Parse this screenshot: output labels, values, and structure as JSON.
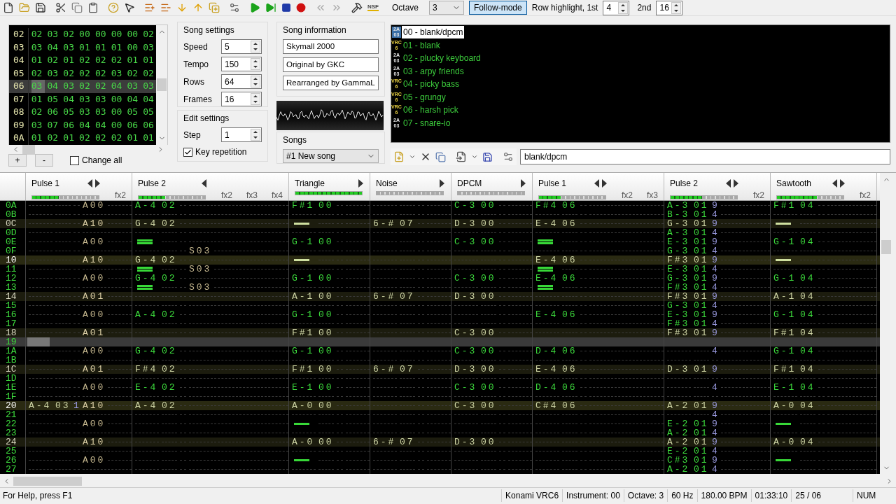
{
  "toolbar": {
    "nsf_label": "NSF",
    "octave_label": "Octave",
    "octave": "3",
    "follow_mode": {
      "label": "Follow-mode",
      "on": true
    },
    "row_highlight_label": "Row highlight, 1st",
    "highlight_1st": "4",
    "second_label": "2nd",
    "highlight_2nd": "16"
  },
  "frames": {
    "rows": [
      {
        "label": "02",
        "values": [
          "02",
          "03",
          "02",
          "00",
          "00",
          "00",
          "00",
          "02"
        ],
        "selected": false
      },
      {
        "label": "03",
        "values": [
          "03",
          "04",
          "03",
          "01",
          "01",
          "01",
          "00",
          "03"
        ],
        "selected": false
      },
      {
        "label": "04",
        "values": [
          "01",
          "02",
          "01",
          "02",
          "02",
          "02",
          "01",
          "01"
        ],
        "selected": false
      },
      {
        "label": "05",
        "values": [
          "02",
          "03",
          "02",
          "02",
          "02",
          "03",
          "02",
          "02"
        ],
        "selected": false
      },
      {
        "label": "06",
        "values": [
          "03",
          "04",
          "03",
          "02",
          "02",
          "04",
          "03",
          "03"
        ],
        "selected": true
      },
      {
        "label": "07",
        "values": [
          "01",
          "05",
          "04",
          "03",
          "03",
          "00",
          "04",
          "04"
        ],
        "selected": false
      },
      {
        "label": "08",
        "values": [
          "02",
          "06",
          "05",
          "03",
          "03",
          "00",
          "05",
          "05"
        ],
        "selected": false
      },
      {
        "label": "09",
        "values": [
          "03",
          "07",
          "06",
          "04",
          "04",
          "00",
          "06",
          "06"
        ],
        "selected": false
      },
      {
        "label": "0A",
        "values": [
          "01",
          "02",
          "01",
          "02",
          "02",
          "02",
          "01",
          "01"
        ],
        "selected": false
      }
    ],
    "add": "+",
    "remove": "-",
    "change_all": {
      "label": "Change all",
      "checked": false
    }
  },
  "song_settings": {
    "title": "Song settings",
    "fields": [
      {
        "label": "Speed",
        "value": "5"
      },
      {
        "label": "Tempo",
        "value": "150"
      },
      {
        "label": "Rows",
        "value": "64"
      },
      {
        "label": "Frames",
        "value": "16"
      }
    ]
  },
  "edit_settings": {
    "title": "Edit settings",
    "step": {
      "label": "Step",
      "value": "1"
    },
    "key_repetition": {
      "label": "Key repetition",
      "checked": true
    }
  },
  "song_information": {
    "title": "Song information",
    "fields": [
      "Skymall 2000",
      "Original by GKC",
      "Rearranged by GammaL"
    ]
  },
  "songs": {
    "title": "Songs",
    "value": "#1 New song"
  },
  "instruments": {
    "items": [
      {
        "chip": [
          "2A",
          "03"
        ],
        "kind": "apu",
        "label": "00 - blank/dpcm",
        "selected": true
      },
      {
        "chip": [
          "VRC",
          "6"
        ],
        "kind": "vrc",
        "label": "01 - blank",
        "selected": false
      },
      {
        "chip": [
          "2A",
          "03"
        ],
        "kind": "apu",
        "label": "02 - plucky keyboard",
        "selected": false
      },
      {
        "chip": [
          "2A",
          "03"
        ],
        "kind": "apu",
        "label": "03 - arpy friends",
        "selected": false
      },
      {
        "chip": [
          "VRC",
          "6"
        ],
        "kind": "vrc",
        "label": "04 - picky bass",
        "selected": false
      },
      {
        "chip": [
          "VRC",
          "6"
        ],
        "kind": "vrc",
        "label": "05 - grungy",
        "selected": false
      },
      {
        "chip": [
          "VRC",
          "6"
        ],
        "kind": "vrc",
        "label": "06 - harsh pick",
        "selected": false
      },
      {
        "chip": [
          "2A",
          "03"
        ],
        "kind": "apu",
        "label": "07 - snare-io",
        "selected": false
      }
    ],
    "name": "blank/dpcm"
  },
  "pattern": {
    "channels": [
      {
        "name": "Pulse 1",
        "left_arrow": true,
        "right_arrow": true,
        "level": 0.4,
        "fx_labels": [
          "fx2"
        ]
      },
      {
        "name": "Pulse 2",
        "left_arrow": true,
        "right_arrow": false,
        "level": 0.4,
        "fx_labels": [
          "fx2",
          "fx3",
          "fx4"
        ]
      },
      {
        "name": "Triangle",
        "left_arrow": false,
        "right_arrow": true,
        "level": 1
      },
      {
        "name": "Noise",
        "left_arrow": false,
        "right_arrow": true,
        "level": 0
      },
      {
        "name": "DPCM",
        "left_arrow": false,
        "right_arrow": true,
        "level": 0
      },
      {
        "name": "Pulse 1",
        "left_arrow": true,
        "right_arrow": true,
        "level": 0.33,
        "fx_labels": [
          "fx2",
          "fx3"
        ]
      },
      {
        "name": "Pulse 2",
        "left_arrow": true,
        "right_arrow": true,
        "level": 0.47,
        "fx_labels": [
          "fx2"
        ]
      },
      {
        "name": "Sawtooth",
        "left_arrow": true,
        "right_arrow": true,
        "level": 0.6,
        "fx_labels": [
          "fx2"
        ]
      }
    ],
    "rows": [
      {
        "label": "0A",
        "beat": false,
        "measure": false,
        "selected": false,
        "cells": [
          {
            "kind": "note",
            "fx1": "A00"
          },
          {
            "kind": "note",
            "note": "A-4",
            "instrument": "02"
          },
          {
            "kind": "note",
            "note": "F#1",
            "instrument": "00"
          },
          null,
          {
            "kind": "note",
            "note": "C-3",
            "instrument": "00"
          },
          {
            "kind": "note",
            "note": "F#4",
            "instrument": "06"
          },
          {
            "kind": "note",
            "note": "A-3",
            "instrument": "01",
            "volume": "9"
          },
          {
            "kind": "note",
            "note": "F#1",
            "instrument": "04"
          }
        ]
      },
      {
        "label": "0B",
        "beat": false,
        "measure": false,
        "selected": false,
        "cells": [
          null,
          null,
          null,
          null,
          null,
          null,
          {
            "kind": "note",
            "note": "B-3",
            "instrument": "01",
            "volume": "4"
          },
          null
        ]
      },
      {
        "label": "0C",
        "beat": true,
        "measure": false,
        "selected": false,
        "cells": [
          {
            "kind": "note",
            "fx1": "A10"
          },
          {
            "kind": "note",
            "note": "G-4",
            "instrument": "02"
          },
          {
            "kind": "off"
          },
          {
            "kind": "note",
            "note": "6-#",
            "instrument": "07"
          },
          {
            "kind": "note",
            "note": "D-3",
            "instrument": "00"
          },
          {
            "kind": "note",
            "note": "E-4",
            "instrument": "06"
          },
          {
            "kind": "note",
            "note": "G-3",
            "instrument": "01",
            "volume": "9"
          },
          {
            "kind": "off"
          }
        ]
      },
      {
        "label": "0D",
        "beat": false,
        "measure": false,
        "selected": false,
        "cells": [
          null,
          null,
          null,
          null,
          null,
          null,
          {
            "kind": "note",
            "note": "A-3",
            "instrument": "01",
            "volume": "4"
          },
          null
        ]
      },
      {
        "label": "0E",
        "beat": false,
        "measure": false,
        "selected": false,
        "cells": [
          {
            "kind": "note",
            "fx1": "A00"
          },
          {
            "kind": "release"
          },
          {
            "kind": "note",
            "note": "G-1",
            "instrument": "00"
          },
          null,
          {
            "kind": "note",
            "note": "C-3",
            "instrument": "00"
          },
          {
            "kind": "release"
          },
          {
            "kind": "note",
            "note": "E-3",
            "instrument": "01",
            "volume": "9"
          },
          {
            "kind": "note",
            "note": "G-1",
            "instrument": "04"
          }
        ]
      },
      {
        "label": "0F",
        "beat": false,
        "measure": false,
        "selected": false,
        "cells": [
          null,
          {
            "kind": "note",
            "fx1": "S03"
          },
          null,
          null,
          null,
          null,
          {
            "kind": "note",
            "note": "G-3",
            "instrument": "01",
            "volume": "4"
          },
          null
        ]
      },
      {
        "label": "10",
        "beat": true,
        "measure": true,
        "selected": false,
        "cells": [
          {
            "kind": "note",
            "fx1": "A10"
          },
          {
            "kind": "note",
            "note": "G-4",
            "instrument": "02"
          },
          {
            "kind": "off"
          },
          null,
          null,
          {
            "kind": "note",
            "note": "E-4",
            "instrument": "06"
          },
          {
            "kind": "note",
            "note": "F#3",
            "instrument": "01",
            "volume": "9"
          },
          {
            "kind": "off"
          }
        ]
      },
      {
        "label": "11",
        "beat": false,
        "measure": false,
        "selected": false,
        "cells": [
          null,
          {
            "kind": "release",
            "fx1": "S03"
          },
          null,
          null,
          null,
          {
            "kind": "release"
          },
          {
            "kind": "note",
            "note": "E-3",
            "instrument": "01",
            "volume": "4"
          },
          null
        ]
      },
      {
        "label": "12",
        "beat": false,
        "measure": false,
        "selected": false,
        "cells": [
          {
            "kind": "note",
            "fx1": "A00"
          },
          {
            "kind": "note",
            "note": "G-4",
            "instrument": "02"
          },
          {
            "kind": "note",
            "note": "G-1",
            "instrument": "00"
          },
          null,
          {
            "kind": "note",
            "note": "C-3",
            "instrument": "00"
          },
          {
            "kind": "note",
            "note": "E-4",
            "instrument": "06"
          },
          {
            "kind": "note",
            "note": "G-3",
            "instrument": "01",
            "volume": "9"
          },
          {
            "kind": "note",
            "note": "G-1",
            "instrument": "04"
          }
        ]
      },
      {
        "label": "13",
        "beat": false,
        "measure": false,
        "selected": false,
        "cells": [
          null,
          {
            "kind": "release",
            "fx1": "S03"
          },
          null,
          null,
          null,
          {
            "kind": "release"
          },
          {
            "kind": "note",
            "note": "F#3",
            "instrument": "01",
            "volume": "4"
          },
          null
        ]
      },
      {
        "label": "14",
        "beat": true,
        "measure": false,
        "selected": false,
        "cells": [
          {
            "kind": "note",
            "fx1": "A01"
          },
          null,
          {
            "kind": "note",
            "note": "A-1",
            "instrument": "00"
          },
          {
            "kind": "note",
            "note": "6-#",
            "instrument": "07"
          },
          {
            "kind": "note",
            "note": "D-3",
            "instrument": "00"
          },
          null,
          {
            "kind": "note",
            "note": "F#3",
            "instrument": "01",
            "volume": "9"
          },
          {
            "kind": "note",
            "note": "A-1",
            "instrument": "04"
          }
        ]
      },
      {
        "label": "15",
        "beat": false,
        "measure": false,
        "selected": false,
        "cells": [
          null,
          null,
          null,
          null,
          null,
          null,
          {
            "kind": "note",
            "note": "G-3",
            "instrument": "01",
            "volume": "4"
          },
          null
        ]
      },
      {
        "label": "16",
        "beat": false,
        "measure": false,
        "selected": false,
        "cells": [
          {
            "kind": "note",
            "fx1": "A00"
          },
          {
            "kind": "note",
            "note": "A-4",
            "instrument": "02"
          },
          {
            "kind": "note",
            "note": "G-1",
            "instrument": "00"
          },
          null,
          null,
          {
            "kind": "note",
            "note": "E-4",
            "instrument": "06"
          },
          {
            "kind": "note",
            "note": "E-3",
            "instrument": "01",
            "volume": "9"
          },
          {
            "kind": "note",
            "note": "G-1",
            "instrument": "04"
          }
        ]
      },
      {
        "label": "17",
        "beat": false,
        "measure": false,
        "selected": false,
        "cells": [
          null,
          null,
          null,
          null,
          null,
          null,
          {
            "kind": "note",
            "note": "F#3",
            "instrument": "01",
            "volume": "4"
          },
          null
        ]
      },
      {
        "label": "18",
        "beat": true,
        "measure": false,
        "selected": false,
        "cells": [
          {
            "kind": "note",
            "fx1": "A01"
          },
          null,
          {
            "kind": "note",
            "note": "F#1",
            "instrument": "00"
          },
          null,
          {
            "kind": "note",
            "note": "C-3",
            "instrument": "00"
          },
          null,
          {
            "kind": "note",
            "note": "F#3",
            "instrument": "01",
            "volume": "9"
          },
          {
            "kind": "note",
            "note": "F#1",
            "instrument": "04"
          }
        ]
      },
      {
        "label": "19",
        "beat": false,
        "measure": false,
        "selected": true,
        "cells": [
          null,
          null,
          null,
          null,
          null,
          null,
          null,
          null
        ]
      },
      {
        "label": "1A",
        "beat": false,
        "measure": false,
        "selected": false,
        "cells": [
          {
            "kind": "note",
            "fx1": "A00"
          },
          {
            "kind": "note",
            "note": "G-4",
            "instrument": "02"
          },
          {
            "kind": "note",
            "note": "G-1",
            "instrument": "00"
          },
          null,
          {
            "kind": "note",
            "note": "C-3",
            "instrument": "00"
          },
          {
            "kind": "note",
            "note": "D-4",
            "instrument": "06"
          },
          {
            "kind": "note",
            "volume": "4"
          },
          {
            "kind": "note",
            "note": "G-1",
            "instrument": "04"
          }
        ]
      },
      {
        "label": "1B",
        "beat": false,
        "measure": false,
        "selected": false,
        "cells": [
          null,
          null,
          null,
          null,
          null,
          null,
          null,
          null
        ]
      },
      {
        "label": "1C",
        "beat": true,
        "measure": false,
        "selected": false,
        "cells": [
          {
            "kind": "note",
            "fx1": "A01"
          },
          {
            "kind": "note",
            "note": "F#4",
            "instrument": "02"
          },
          {
            "kind": "note",
            "note": "F#1",
            "instrument": "00"
          },
          {
            "kind": "note",
            "note": "6-#",
            "instrument": "07"
          },
          {
            "kind": "note",
            "note": "D-3",
            "instrument": "00"
          },
          {
            "kind": "note",
            "note": "E-4",
            "instrument": "06"
          },
          {
            "kind": "note",
            "note": "D-3",
            "instrument": "01",
            "volume": "9"
          },
          {
            "kind": "note",
            "note": "F#1",
            "instrument": "04"
          }
        ]
      },
      {
        "label": "1D",
        "beat": false,
        "measure": false,
        "selected": false,
        "cells": [
          null,
          null,
          null,
          null,
          null,
          null,
          null,
          null
        ]
      },
      {
        "label": "1E",
        "beat": false,
        "measure": false,
        "selected": false,
        "cells": [
          {
            "kind": "note",
            "fx1": "A00"
          },
          {
            "kind": "note",
            "note": "E-4",
            "instrument": "02"
          },
          {
            "kind": "note",
            "note": "E-1",
            "instrument": "00"
          },
          null,
          {
            "kind": "note",
            "note": "C-3",
            "instrument": "00"
          },
          {
            "kind": "note",
            "note": "D-4",
            "instrument": "06"
          },
          {
            "kind": "note",
            "volume": "4"
          },
          {
            "kind": "note",
            "note": "E-1",
            "instrument": "04"
          }
        ]
      },
      {
        "label": "1F",
        "beat": false,
        "measure": false,
        "selected": false,
        "cells": [
          null,
          null,
          null,
          null,
          null,
          null,
          null,
          null
        ]
      },
      {
        "label": "20",
        "beat": true,
        "measure": true,
        "selected": false,
        "cells": [
          {
            "kind": "note",
            "note": "A-4",
            "instrument": "03",
            "volume": "1",
            "fx1": "A10"
          },
          {
            "kind": "note",
            "note": "A-4",
            "instrument": "02"
          },
          {
            "kind": "note",
            "note": "A-0",
            "instrument": "00"
          },
          null,
          {
            "kind": "note",
            "note": "C-3",
            "instrument": "00"
          },
          {
            "kind": "note",
            "note": "C#4",
            "instrument": "06"
          },
          {
            "kind": "note",
            "note": "A-2",
            "instrument": "01",
            "volume": "9"
          },
          {
            "kind": "note",
            "note": "A-0",
            "instrument": "04"
          }
        ]
      },
      {
        "label": "21",
        "beat": false,
        "measure": false,
        "selected": false,
        "cells": [
          null,
          null,
          null,
          null,
          null,
          null,
          {
            "kind": "note",
            "volume": "4"
          },
          null
        ]
      },
      {
        "label": "22",
        "beat": false,
        "measure": false,
        "selected": false,
        "cells": [
          {
            "kind": "note",
            "fx1": "A00"
          },
          null,
          {
            "kind": "off"
          },
          null,
          null,
          null,
          {
            "kind": "note",
            "note": "E-2",
            "instrument": "01",
            "volume": "9"
          },
          {
            "kind": "off"
          }
        ]
      },
      {
        "label": "23",
        "beat": false,
        "measure": false,
        "selected": false,
        "cells": [
          null,
          null,
          null,
          null,
          null,
          null,
          {
            "kind": "note",
            "note": "A-2",
            "instrument": "01",
            "volume": "4"
          },
          null
        ]
      },
      {
        "label": "24",
        "beat": true,
        "measure": false,
        "selected": false,
        "cells": [
          {
            "kind": "note",
            "fx1": "A10"
          },
          null,
          {
            "kind": "note",
            "note": "A-0",
            "instrument": "00"
          },
          {
            "kind": "note",
            "note": "6-#",
            "instrument": "07"
          },
          {
            "kind": "note",
            "note": "D-3",
            "instrument": "00"
          },
          null,
          {
            "kind": "note",
            "note": "A-2",
            "instrument": "01",
            "volume": "9"
          },
          {
            "kind": "note",
            "note": "A-0",
            "instrument": "04"
          }
        ]
      },
      {
        "label": "25",
        "beat": false,
        "measure": false,
        "selected": false,
        "cells": [
          null,
          null,
          null,
          null,
          null,
          null,
          {
            "kind": "note",
            "note": "E-2",
            "instrument": "01",
            "volume": "4"
          },
          null
        ]
      },
      {
        "label": "26",
        "beat": false,
        "measure": false,
        "selected": false,
        "cells": [
          {
            "kind": "note",
            "fx1": "A00"
          },
          null,
          {
            "kind": "off"
          },
          null,
          null,
          null,
          {
            "kind": "note",
            "note": "C#3",
            "instrument": "01",
            "volume": "9"
          },
          {
            "kind": "off"
          }
        ]
      },
      {
        "label": "27",
        "beat": false,
        "measure": false,
        "selected": false,
        "cells": [
          null,
          null,
          null,
          null,
          null,
          null,
          {
            "kind": "note",
            "note": "A-2",
            "instrument": "01",
            "volume": "4"
          },
          null
        ]
      }
    ]
  },
  "status_bar": {
    "help": "For Help, press F1",
    "panes": [
      "Konami VRC6",
      "Instrument: 00",
      "Octave: 3",
      "60 Hz",
      "180.00 BPM",
      "01:33:10",
      "25 / 06",
      "NUM"
    ]
  }
}
